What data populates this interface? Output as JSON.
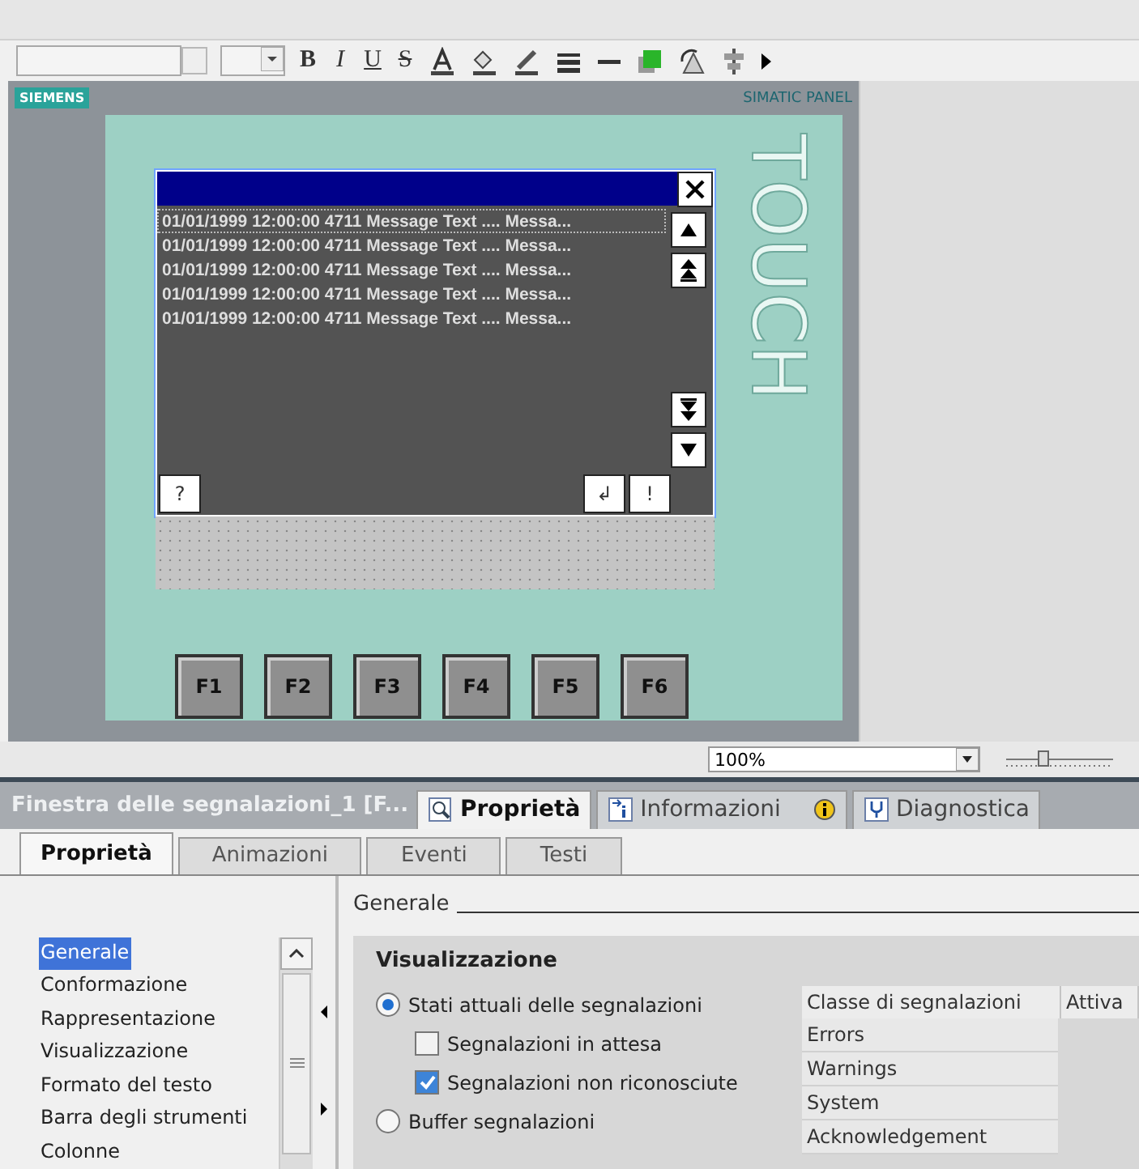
{
  "toolbar": {
    "format_buttons": [
      "B",
      "I",
      "U",
      "S"
    ]
  },
  "panel": {
    "brand": "SIEMENS",
    "model": "SIMATIC PANEL",
    "vertical_label": "TOUCH",
    "alarm_view": {
      "rows": [
        {
          "text": "01/01/1999 12:00:00  4711 Message Text .... Messa...",
          "selected": true
        },
        {
          "text": "01/01/1999 12:00:00  4711 Message Text .... Messa...",
          "selected": false
        },
        {
          "text": "01/01/1999 12:00:00  4711 Message Text .... Messa...",
          "selected": false
        },
        {
          "text": "01/01/1999 12:00:00  4711 Message Text .... Messa...",
          "selected": false
        },
        {
          "text": "01/01/1999 12:00:00  4711 Message Text .... Messa...",
          "selected": false
        }
      ],
      "help_key": "?",
      "ack_keys": [
        "↲",
        "!"
      ]
    },
    "function_keys": [
      "F1",
      "F2",
      "F3",
      "F4",
      "F5",
      "F6"
    ]
  },
  "zoom": {
    "value": "100%"
  },
  "inspector": {
    "title": "Finestra delle segnalazioni_1 [F...",
    "tabs": [
      {
        "label": "Proprietà",
        "selected": true
      },
      {
        "label": "Informazioni",
        "selected": false
      },
      {
        "label": "Diagnostica",
        "selected": false
      }
    ],
    "subtabs": [
      {
        "label": "Proprietà",
        "selected": true
      },
      {
        "label": "Animazioni",
        "selected": false
      },
      {
        "label": "Eventi",
        "selected": false
      },
      {
        "label": "Testi",
        "selected": false
      }
    ],
    "nav": [
      {
        "label": "Generale",
        "selected": true
      },
      {
        "label": "Conformazione",
        "selected": false
      },
      {
        "label": "Rappresentazione",
        "selected": false
      },
      {
        "label": "Visualizzazione",
        "selected": false
      },
      {
        "label": "Formato del testo",
        "selected": false
      },
      {
        "label": "Barra degli strumenti",
        "selected": false
      },
      {
        "label": "Colonne",
        "selected": false
      }
    ],
    "section": "Generale",
    "group": "Visualizzazione",
    "options": [
      {
        "kind": "radio",
        "label": "Stati attuali delle segnalazioni",
        "selected": true
      },
      {
        "kind": "checkbox",
        "label": "Segnalazioni in attesa",
        "checked": false
      },
      {
        "kind": "checkbox",
        "label": "Segnalazioni non riconosciute",
        "checked": true
      },
      {
        "kind": "radio",
        "label": "Buffer segnalazioni",
        "selected": false
      }
    ],
    "table": {
      "columns": [
        "Classe di segnalazioni",
        "Attiva"
      ],
      "rows": [
        "Errors",
        "Warnings",
        "System",
        "Acknowledgement"
      ]
    }
  }
}
